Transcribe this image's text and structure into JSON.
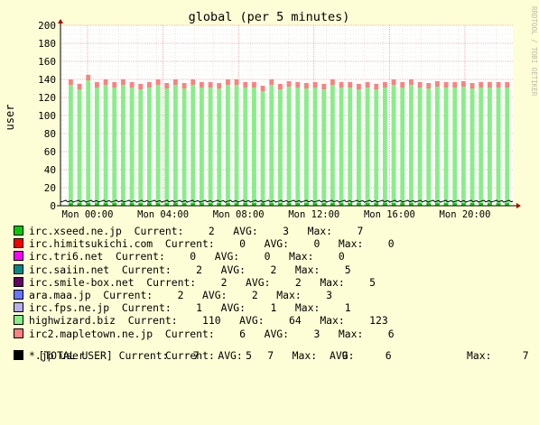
{
  "chart_data": {
    "type": "bar",
    "title": "global (per 5 minutes)",
    "ylabel": "user",
    "watermark": "RRDTOOL / TOBI OETIKER",
    "ylim": [
      0,
      200
    ],
    "y_ticks": [
      0,
      20,
      40,
      60,
      80,
      100,
      120,
      140,
      160,
      180,
      200
    ],
    "x_ticks": [
      "Mon 00:00",
      "Mon 04:00",
      "Mon 08:00",
      "Mon 12:00",
      "Mon 16:00",
      "Mon 20:00"
    ],
    "grid": true,
    "series": [
      {
        "name": "irc.xseed.ne.jp",
        "color": "#00cc00",
        "current": "2",
        "avg": "3",
        "max": "7"
      },
      {
        "name": "irc.himitsukichi.com",
        "color": "#ff0000",
        "current": "0",
        "avg": "0",
        "max": "0"
      },
      {
        "name": "irc.tri6.net",
        "color": "#ff00ff",
        "current": "0",
        "avg": "0",
        "max": "0"
      },
      {
        "name": "irc.saiin.net",
        "color": "#008888",
        "current": "2",
        "avg": "2",
        "max": "5"
      },
      {
        "name": "irc.smile-box.net",
        "color": "#660066",
        "current": "2",
        "avg": "2",
        "max": "5"
      },
      {
        "name": "ara.maa.jp",
        "color": "#6677ff",
        "current": "2",
        "avg": "2",
        "max": "3"
      },
      {
        "name": "irc.fps.ne.jp",
        "color": "#b8b0ee",
        "current": "1",
        "avg": "1",
        "max": "1"
      },
      {
        "name": "highwizard.biz",
        "color": "#88ee88",
        "current": "110",
        "avg": "64",
        "max": "123"
      },
      {
        "name": "irc2.mapletown.ne.jp",
        "color": "#ff8080",
        "current": "6",
        "avg": "3",
        "max": "6"
      }
    ],
    "bar_totals": [
      140,
      135,
      145,
      137,
      140,
      137,
      140,
      137,
      135,
      137,
      140,
      136,
      140,
      136,
      140,
      137,
      137,
      136,
      140,
      140,
      137,
      137,
      133,
      140,
      135,
      138,
      137,
      136,
      137,
      135,
      140,
      137,
      137,
      135,
      137,
      135,
      137,
      140,
      137,
      140,
      137,
      136,
      138,
      137,
      137,
      138,
      136,
      137,
      137,
      137,
      137
    ],
    "total": {
      "label": "[TOTAL USER]",
      "current": "7",
      "avg": "7",
      "max": "9"
    },
    "jp": {
      "label": "*.jp user",
      "current": "5",
      "avg": "6",
      "max": "7"
    }
  },
  "labels": {
    "current": "Current:",
    "avg": "AVG:",
    "max": "Max:"
  }
}
